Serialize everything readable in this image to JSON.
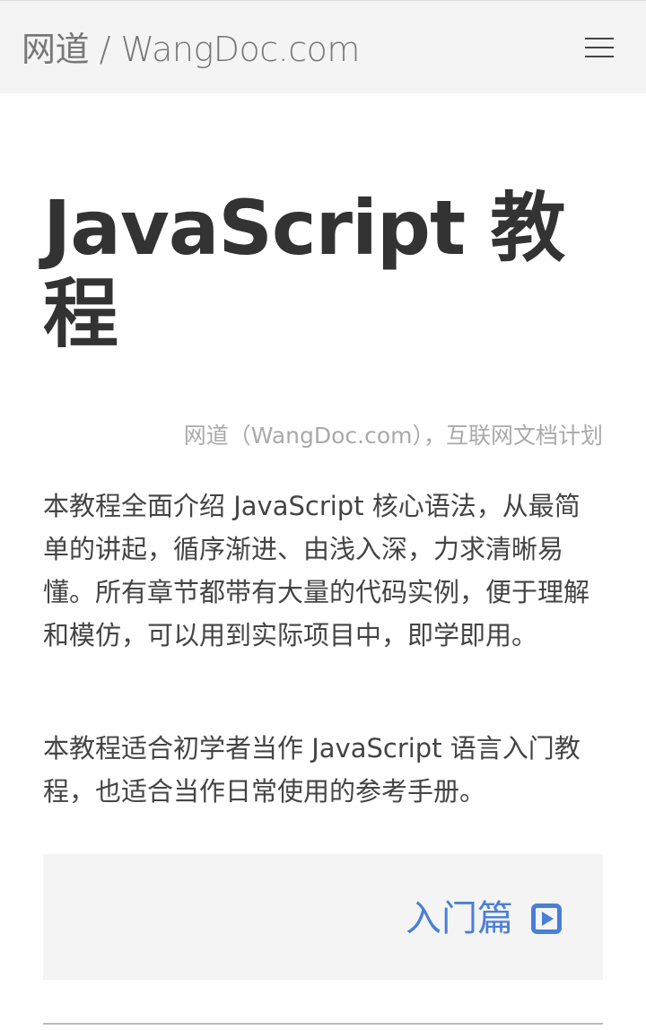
{
  "header": {
    "site_title": "网道 / WangDoc.com",
    "menu_icon": "hamburger-menu-icon"
  },
  "main": {
    "title": "JavaScript 教程",
    "subtitle": "网道（WangDoc.com），互联网文档计划",
    "paragraphs": [
      "本教程全面介绍 JavaScript 核心语法，从最简单的讲起，循序渐进、由浅入深，力求清晰易懂。所有章节都带有大量的代码实例，便于理解和模仿，可以用到实际项目中，即学即用。",
      "本教程适合初学者当作 JavaScript 语言入门教程，也适合当作日常使用的参考手册。"
    ],
    "next_link": {
      "label": "入门篇",
      "icon": "play-square-icon"
    }
  },
  "colors": {
    "header_bg": "#f4f4f4",
    "link": "#4a7fd6",
    "text": "#333333",
    "muted": "#aaaaaa"
  }
}
